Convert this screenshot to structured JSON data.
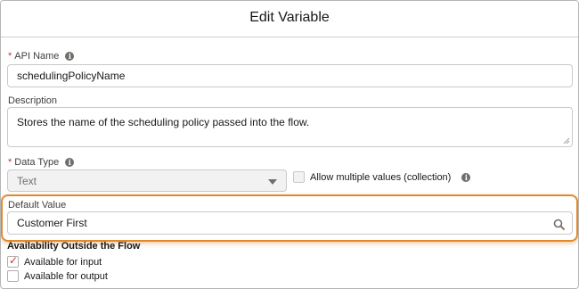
{
  "modal": {
    "title": "Edit Variable"
  },
  "api_name": {
    "required_mark": "*",
    "label": "API Name",
    "info_icon": "info-icon",
    "value": "schedulingPolicyName"
  },
  "description": {
    "label": "Description",
    "value": "Stores the name of the scheduling policy passed into the flow."
  },
  "data_type": {
    "required_mark": "*",
    "label": "Data Type",
    "info_icon": "info-icon",
    "selected": "Text",
    "caret_icon": "chevron-down-icon"
  },
  "collection": {
    "label": "Allow multiple values (collection)",
    "checked": false,
    "info_icon": "info-icon"
  },
  "default_value": {
    "label": "Default Value",
    "value": "Customer First",
    "search_icon": "search-icon"
  },
  "availability": {
    "title": "Availability Outside the Flow",
    "input": {
      "label": "Available for input",
      "checked": true
    },
    "output": {
      "label": "Available for output",
      "checked": false
    }
  },
  "colors": {
    "highlight": "#e08a2e",
    "required": "#c23934",
    "check": "#c23934"
  }
}
